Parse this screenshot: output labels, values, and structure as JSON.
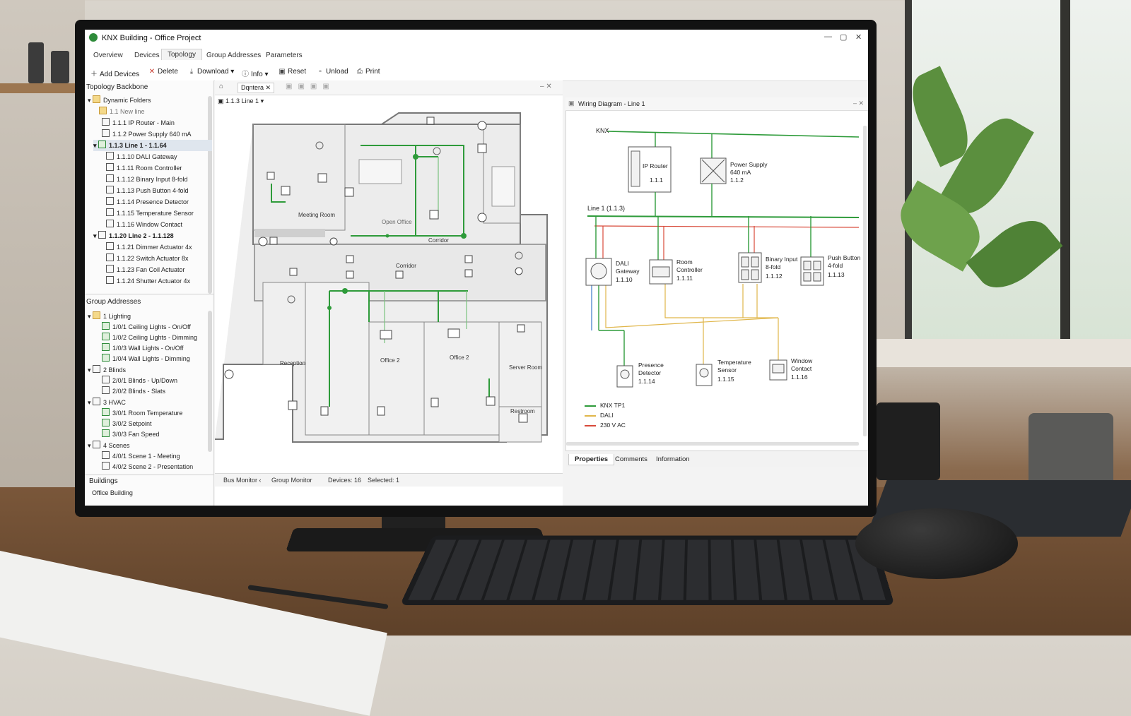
{
  "app": {
    "title": "KNX Building - Office Project",
    "window_controls": [
      "—",
      "▢",
      "✕"
    ]
  },
  "tabs": [
    {
      "label": "Overview"
    },
    {
      "label": "Devices"
    },
    {
      "label": "Topology",
      "active": true
    },
    {
      "label": "Group Addresses"
    },
    {
      "label": "Parameters"
    }
  ],
  "toolbar": {
    "add_devices": "Add Devices",
    "delete": "Delete",
    "download": "Download",
    "info": "Info",
    "reset": "Reset",
    "unload": "Unload",
    "print": "Print"
  },
  "topology": {
    "header": "Topology Backbone",
    "items": [
      {
        "label": "Dynamic Folders"
      },
      {
        "label": "1.1 New line"
      },
      {
        "label": "1.1.1 IP Router - Main"
      },
      {
        "label": "1.1.2 Power Supply 640 mA"
      },
      {
        "label": "1.1.3 Line 1 - 1.1.64"
      },
      {
        "label": "1.1.10 DALI Gateway"
      },
      {
        "label": "1.1.11 Room Controller"
      },
      {
        "label": "1.1.12 Binary Input 8-fold"
      },
      {
        "label": "1.1.13 Push Button 4-fold"
      },
      {
        "label": "1.1.14 Presence Detector"
      },
      {
        "label": "1.1.15 Temperature Sensor"
      },
      {
        "label": "1.1.16 Window Contact"
      },
      {
        "label": "1.1.20 Line 2 - 1.1.128"
      },
      {
        "label": "1.1.21 Dimmer Actuator 4x"
      },
      {
        "label": "1.1.22 Switch Actuator 8x"
      },
      {
        "label": "1.1.23 Fan Coil Actuator"
      },
      {
        "label": "1.1.24 Shutter Actuator 4x"
      }
    ]
  },
  "group_addresses": {
    "header": "Group Addresses",
    "items": [
      {
        "label": "1 Lighting"
      },
      {
        "label": "1/0/1  Ceiling Lights - On/Off"
      },
      {
        "label": "1/0/2  Ceiling Lights - Dimming"
      },
      {
        "label": "1/0/3  Wall Lights - On/Off"
      },
      {
        "label": "1/0/4  Wall Lights - Dimming"
      },
      {
        "label": "2 Blinds"
      },
      {
        "label": "2/0/1  Blinds - Up/Down"
      },
      {
        "label": "2/0/2  Blinds - Slats"
      },
      {
        "label": "3 HVAC"
      },
      {
        "label": "3/0/1  Room Temperature"
      },
      {
        "label": "3/0/2  Setpoint"
      },
      {
        "label": "3/0/3  Fan Speed"
      },
      {
        "label": "4 Scenes"
      },
      {
        "label": "4/0/1  Scene 1 - Meeting"
      },
      {
        "label": "4/0/2  Scene 2 - Presentation"
      }
    ]
  },
  "buildings": {
    "header": "Buildings",
    "item": "Office Building"
  },
  "plan": {
    "tab": "Dqntera",
    "line_selector": "1.1.3 Line 1",
    "rooms": {
      "meeting_room": "Meeting Room",
      "open_office": "Open Office",
      "corridor_top": "Corridor",
      "corridor_mid": "Corridor",
      "reception": "Reception",
      "office2a": "Office 2",
      "office2b": "Office 2",
      "server_room": "Server Room",
      "restroom": "Restroom"
    }
  },
  "status_bar": {
    "bus_monitor": "Bus Monitor",
    "group_monitor": "Group Monitor",
    "devices": "Devices: 16",
    "selected": "Selected: 1"
  },
  "wiring": {
    "header": "Wiring Diagram - Line 1",
    "knx_label": "KNX",
    "line_label": "Line 1",
    "line_id": "(1.1.3)",
    "devices": {
      "ip_router": {
        "name": "IP Router",
        "addr": "1.1.1"
      },
      "power_supply": {
        "name": "Power Supply",
        "sub": "640 mA",
        "addr": "1.1.2"
      },
      "dali_gateway": {
        "name": "DALI",
        "sub": "Gateway",
        "addr": "1.1.10"
      },
      "room_controller": {
        "name": "Room",
        "sub": "Controller",
        "addr": "1.1.11"
      },
      "binary_input": {
        "name": "Binary Input",
        "sub": "8-fold",
        "addr": "1.1.12"
      },
      "push_button": {
        "name": "Push Button",
        "sub": "4-fold",
        "addr": "1.1.13"
      },
      "presence_detector": {
        "name": "Presence",
        "sub": "Detector",
        "addr": "1.1.14"
      },
      "temperature_sensor": {
        "name": "Temperature",
        "sub": "Sensor",
        "addr": "1.1.15"
      },
      "window_contact": {
        "name": "Window",
        "sub": "Contact",
        "addr": "1.1.16"
      }
    },
    "legend": [
      {
        "label": "KNX TP1",
        "color": "#2e9b3a"
      },
      {
        "label": "DALI",
        "color": "#e0b64a"
      },
      {
        "label": "230 V AC",
        "color": "#d84a3a"
      }
    ]
  },
  "bottom_tabs": [
    {
      "label": "Properties",
      "active": true
    },
    {
      "label": "Comments"
    },
    {
      "label": "Information"
    }
  ],
  "colors": {
    "accent_green": "#2e9b3a",
    "dali": "#e0b64a",
    "mains": "#d84a3a",
    "selection": "#dfe6ee"
  }
}
